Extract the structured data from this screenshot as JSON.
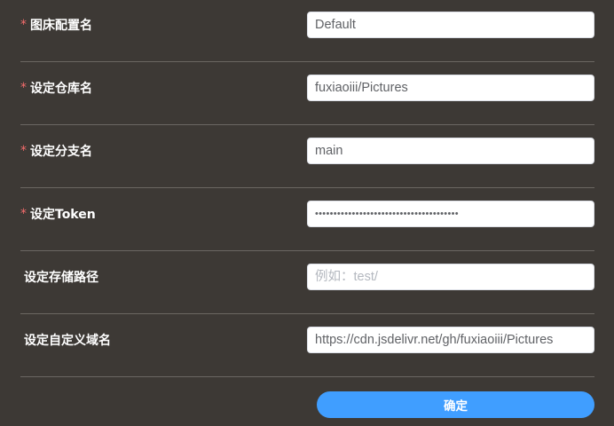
{
  "form": {
    "fields": [
      {
        "required_mark": "*",
        "label": "图床配置名",
        "value": "Default",
        "placeholder": ""
      },
      {
        "required_mark": "*",
        "label": "设定仓库名",
        "value": "fuxiaoiii/Pictures",
        "placeholder": ""
      },
      {
        "required_mark": "*",
        "label": "设定分支名",
        "value": "main",
        "placeholder": ""
      },
      {
        "required_mark": "*",
        "label": "设定Token",
        "value": "•••••••••••••••••••••••••••••••••••••••",
        "placeholder": ""
      },
      {
        "required_mark": "",
        "label": "设定存储路径",
        "value": "",
        "placeholder": "例如：test/"
      },
      {
        "required_mark": "",
        "label": "设定自定义域名",
        "value": "https://cdn.jsdelivr.net/gh/fuxiaoiii/Pictures",
        "placeholder": ""
      }
    ],
    "submit_label": "确定"
  },
  "colors": {
    "background": "#3d3935",
    "divider": "#6b6762",
    "required_mark": "#f56c6c",
    "primary_button": "#409eff"
  }
}
